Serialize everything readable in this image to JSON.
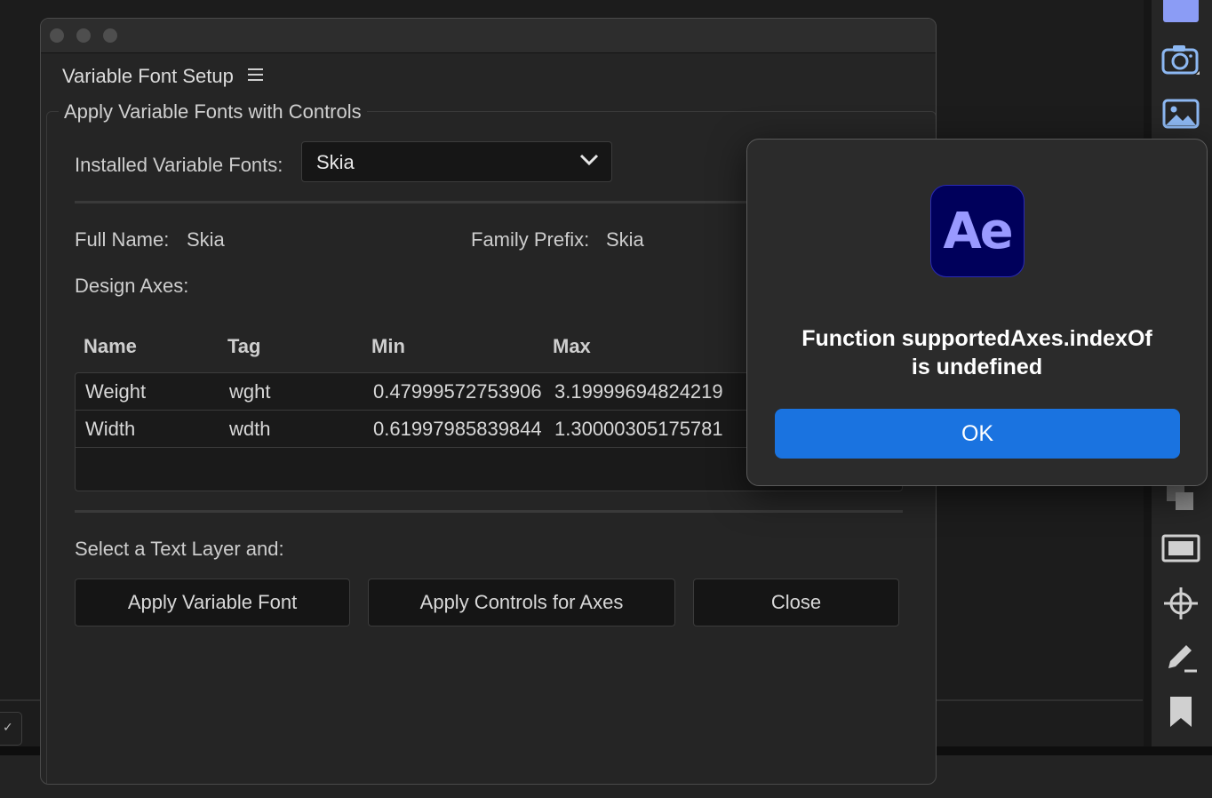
{
  "window": {
    "title": "Variable Font Setup",
    "group_label": "Apply Variable Fonts with Controls",
    "installed_fonts_label": "Installed Variable Fonts:",
    "selected_font": "Skia",
    "full_name_label": "Full Name:",
    "full_name_value": "Skia",
    "family_prefix_label": "Family Prefix:",
    "family_prefix_value": "Skia",
    "design_axes_label": "Design Axes:",
    "table": {
      "headers": [
        "Name",
        "Tag",
        "Min",
        "Max"
      ],
      "rows": [
        [
          "Weight",
          "wght",
          "0.47999572753906",
          "3.19999694824219"
        ],
        [
          "Width",
          "wdth",
          "0.61997985839844",
          "1.30000305175781"
        ]
      ]
    },
    "select_text_label": "Select a Text Layer and:",
    "buttons": {
      "apply_font": "Apply Variable Font",
      "apply_controls": "Apply Controls for Axes",
      "close": "Close"
    }
  },
  "alert": {
    "app_icon_text": "Ae",
    "message_line1": "Function supportedAxes.indexOf",
    "message_line2": "is undefined",
    "ok_label": "OK",
    "ok_color": "#1a73e0"
  },
  "toolbar_icons": [
    "rectangle-icon",
    "camera-icon",
    "image-icon",
    "layers-icon",
    "monitor-icon",
    "crosshair-icon",
    "pen-icon",
    "bookmark-icon"
  ],
  "left_edge_glyph": "✓"
}
